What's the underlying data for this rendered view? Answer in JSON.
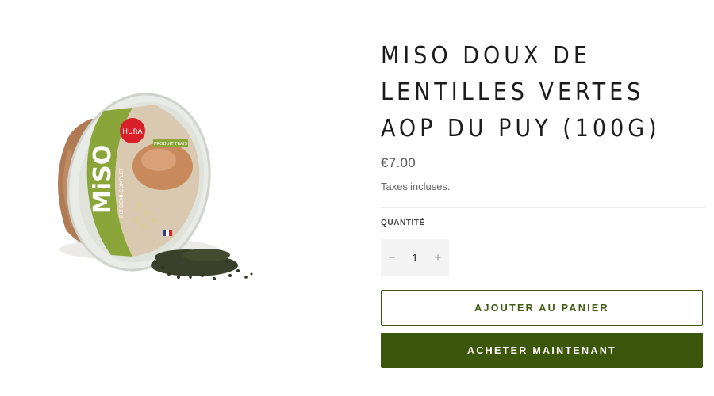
{
  "product": {
    "title": "MISO DOUX DE LENTILLES VERTES AOP DU PUY (100G)",
    "price": "€7.00",
    "tax_label": "Taxes",
    "tax_note": "incluses.",
    "image": {
      "brand": "HŪRA",
      "product_word": "MiSO",
      "variant_text": "RIZ DEMI-COMPLET",
      "badge_text": "PRODUIT FRAIS"
    }
  },
  "quantity": {
    "label": "QUANTITÉ",
    "value": "1",
    "decrement_symbol": "−",
    "increment_symbol": "+"
  },
  "buttons": {
    "add_to_cart": "AJOUTER AU PANIER",
    "buy_now": "ACHETER MAINTENANT"
  },
  "colors": {
    "accent": "#3c570c",
    "label_green": "#7a9a30",
    "logo_red": "#d81f2a"
  }
}
